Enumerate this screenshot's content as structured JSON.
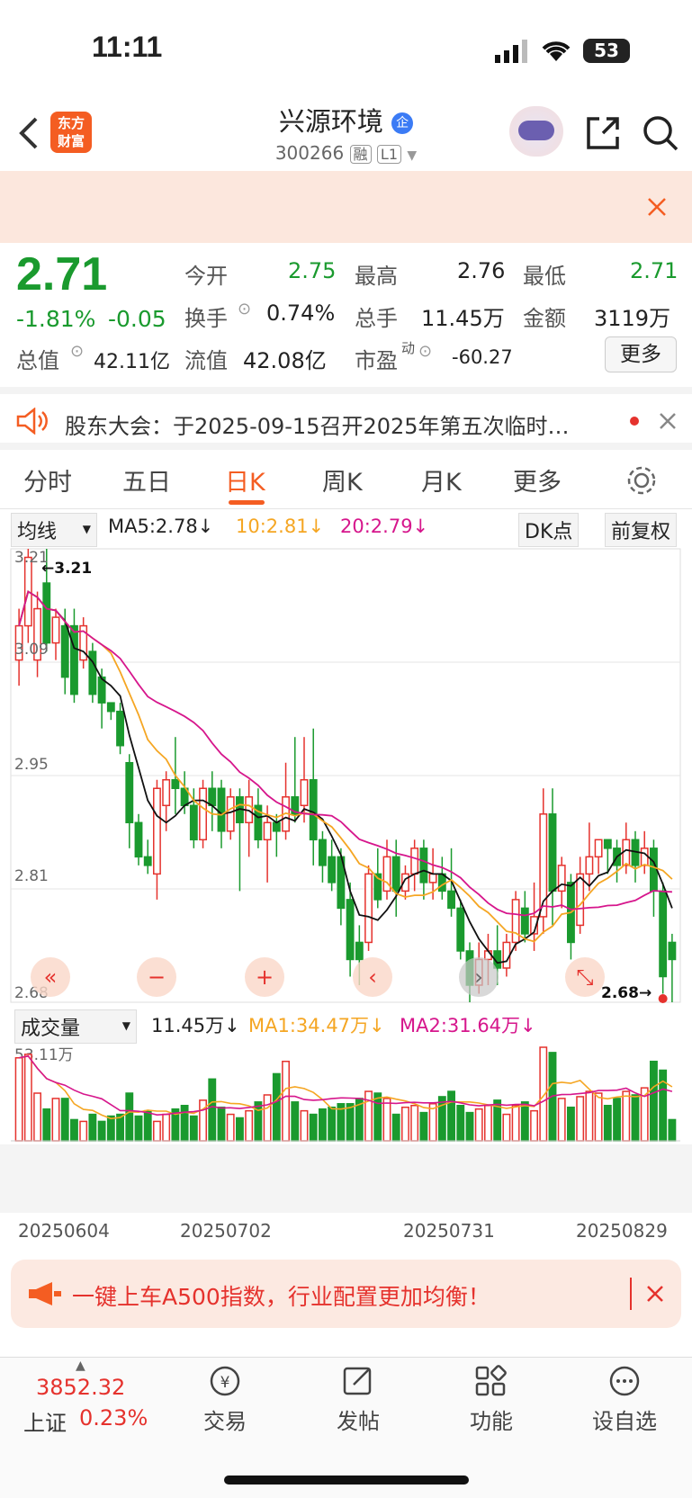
{
  "status": {
    "time": "11:11",
    "battery": "53"
  },
  "header": {
    "back_icon": "chevron-left-icon",
    "logo_text": "东方\n财富",
    "title": "兴源环境",
    "title_badge": "企",
    "code": "300266",
    "tag1": "融",
    "tag2": "L1"
  },
  "quote": {
    "price": "2.71",
    "change_pct": "-1.81%",
    "change": "-0.05",
    "open_label": "今开",
    "open": "2.75",
    "high_label": "最高",
    "high": "2.76",
    "low_label": "最低",
    "low": "2.71",
    "turnover_label": "换手",
    "turnover": "0.74%",
    "volume_label": "总手",
    "volume": "11.45万",
    "amount_label": "金额",
    "amount": "3119万",
    "mktcap_label": "总值",
    "mktcap": "42.11亿",
    "float_label": "流值",
    "float": "42.08亿",
    "pe_label": "市盈",
    "pe_sup": "动",
    "pe": "-60.27",
    "more_label": "更多"
  },
  "notice": {
    "text": "股东大会：于2025-09-15召开2025年第五次临时…"
  },
  "tabs": [
    "分时",
    "五日",
    "日K",
    "周K",
    "月K",
    "更多"
  ],
  "active_tab": "日K",
  "chart_toolbar": {
    "ma_select": "均线",
    "ma5": "MA5:2.78↓",
    "ma10": "10:2.81↓",
    "ma20": "20:2.79↓",
    "dk": "DK点",
    "adjust": "前复权"
  },
  "vol_toolbar": {
    "select": "成交量",
    "vol": "11.45万↓",
    "ma1": "MA1:34.47万↓",
    "ma2": "MA2:31.64万↓",
    "max_label": "53.11万"
  },
  "chart_labels": {
    "y_top": "3.21",
    "y_mid1": "3.09",
    "y_mid2": "2.95",
    "y_mid3": "2.81",
    "y_bot": "2.68",
    "high_mark": "←3.21",
    "low_mark": "2.68→"
  },
  "x_dates": [
    "20250604",
    "20250702",
    "20250731",
    "20250829"
  ],
  "banner2": {
    "text": "一键上车A500指数，行业配置更加均衡！"
  },
  "bottom": {
    "index_value": "3852.32",
    "index_name": "上证",
    "index_change": "0.23%",
    "items": [
      "交易",
      "发帖",
      "功能",
      "设自选"
    ]
  },
  "colors": {
    "up": "#e5322d",
    "down": "#1a9a2e",
    "ma5": "#111111",
    "ma10": "#f5a623",
    "ma20": "#d6168c",
    "accent": "#f45d22"
  },
  "chart_data": {
    "type": "candlestick",
    "ylim": [
      2.68,
      3.21
    ],
    "candles": [
      [
        3.08,
        3.12,
        3.05,
        3.14
      ],
      [
        3.12,
        3.2,
        3.1,
        3.21
      ],
      [
        3.08,
        3.14,
        3.06,
        3.16
      ],
      [
        3.17,
        3.1,
        3.09,
        3.21
      ],
      [
        3.1,
        3.13,
        3.08,
        3.14
      ],
      [
        3.12,
        3.06,
        3.04,
        3.14
      ],
      [
        3.12,
        3.04,
        3.03,
        3.14
      ],
      [
        3.08,
        3.12,
        3.07,
        3.13
      ],
      [
        3.09,
        3.04,
        3.03,
        3.1
      ],
      [
        3.06,
        3.03,
        3.0,
        3.07
      ],
      [
        3.03,
        3.02,
        3.01,
        3.03
      ],
      [
        3.02,
        2.98,
        2.97,
        3.03
      ],
      [
        2.96,
        2.89,
        2.86,
        2.97
      ],
      [
        2.89,
        2.85,
        2.84,
        2.9
      ],
      [
        2.85,
        2.84,
        2.83,
        2.87
      ],
      [
        2.83,
        2.93,
        2.8,
        2.94
      ],
      [
        2.91,
        2.94,
        2.88,
        2.95
      ],
      [
        2.94,
        2.93,
        2.9,
        2.99
      ],
      [
        2.93,
        2.91,
        2.9,
        2.95
      ],
      [
        2.91,
        2.87,
        2.86,
        2.93
      ],
      [
        2.87,
        2.93,
        2.86,
        2.94
      ],
      [
        2.93,
        2.91,
        2.88,
        2.95
      ],
      [
        2.93,
        2.88,
        2.86,
        2.94
      ],
      [
        2.88,
        2.92,
        2.87,
        2.93
      ],
      [
        2.92,
        2.89,
        2.81,
        2.93
      ],
      [
        2.89,
        2.92,
        2.85,
        2.94
      ],
      [
        2.91,
        2.87,
        2.86,
        2.93
      ],
      [
        2.87,
        2.89,
        2.82,
        2.91
      ],
      [
        2.89,
        2.88,
        2.85,
        2.9
      ],
      [
        2.88,
        2.92,
        2.87,
        2.96
      ],
      [
        2.92,
        2.9,
        2.89,
        2.99
      ],
      [
        2.91,
        2.94,
        2.89,
        2.99
      ],
      [
        2.94,
        2.87,
        2.84,
        3.0
      ],
      [
        2.87,
        2.84,
        2.82,
        2.88
      ],
      [
        2.85,
        2.82,
        2.81,
        2.87
      ],
      [
        2.85,
        2.79,
        2.77,
        2.86
      ],
      [
        2.8,
        2.73,
        2.71,
        2.82
      ],
      [
        2.75,
        2.73,
        2.7,
        2.77
      ],
      [
        2.75,
        2.83,
        2.74,
        2.84
      ],
      [
        2.83,
        2.8,
        2.79,
        2.86
      ],
      [
        2.81,
        2.85,
        2.8,
        2.87
      ],
      [
        2.85,
        2.81,
        2.78,
        2.87
      ],
      [
        2.81,
        2.83,
        2.8,
        2.84
      ],
      [
        2.83,
        2.86,
        2.81,
        2.87
      ],
      [
        2.86,
        2.82,
        2.8,
        2.87
      ],
      [
        2.82,
        2.83,
        2.8,
        2.86
      ],
      [
        2.83,
        2.81,
        2.8,
        2.85
      ],
      [
        2.81,
        2.79,
        2.78,
        2.86
      ],
      [
        2.79,
        2.74,
        2.73,
        2.8
      ],
      [
        2.74,
        2.7,
        2.68,
        2.75
      ],
      [
        2.7,
        2.73,
        2.69,
        2.75
      ],
      [
        2.73,
        2.74,
        2.7,
        2.76
      ],
      [
        2.74,
        2.72,
        2.7,
        2.77
      ],
      [
        2.72,
        2.75,
        2.71,
        2.76
      ],
      [
        2.75,
        2.8,
        2.74,
        2.81
      ],
      [
        2.79,
        2.76,
        2.75,
        2.81
      ],
      [
        2.76,
        2.78,
        2.74,
        2.82
      ],
      [
        2.78,
        2.9,
        2.76,
        2.93
      ],
      [
        2.9,
        2.81,
        2.77,
        2.93
      ],
      [
        2.81,
        2.84,
        2.79,
        2.85
      ],
      [
        2.82,
        2.75,
        2.73,
        2.83
      ],
      [
        2.77,
        2.83,
        2.76,
        2.85
      ],
      [
        2.83,
        2.85,
        2.81,
        2.89
      ],
      [
        2.85,
        2.87,
        2.83,
        2.87
      ],
      [
        2.87,
        2.86,
        2.83,
        2.87
      ],
      [
        2.86,
        2.84,
        2.82,
        2.87
      ],
      [
        2.84,
        2.87,
        2.83,
        2.89
      ],
      [
        2.87,
        2.84,
        2.82,
        2.88
      ],
      [
        2.84,
        2.86,
        2.83,
        2.88
      ],
      [
        2.86,
        2.81,
        2.78,
        2.87
      ],
      [
        2.81,
        2.71,
        2.69,
        2.82
      ],
      [
        2.75,
        2.73,
        2.68,
        2.76
      ]
    ],
    "volume": [
      47,
      49,
      27,
      18,
      24,
      24,
      12,
      11,
      15,
      11,
      14,
      15,
      27,
      14,
      17,
      11,
      15,
      18,
      20,
      14,
      23,
      35,
      19,
      15,
      13,
      17,
      22,
      26,
      38,
      45,
      22,
      17,
      15,
      18,
      19,
      21,
      21,
      24,
      28,
      27,
      24,
      15,
      19,
      20,
      16,
      21,
      25,
      28,
      20,
      16,
      18,
      20,
      23,
      15,
      20,
      22,
      17,
      53,
      50,
      24,
      19,
      25,
      28,
      27,
      20,
      24,
      28,
      26,
      30,
      45,
      40,
      12
    ]
  }
}
